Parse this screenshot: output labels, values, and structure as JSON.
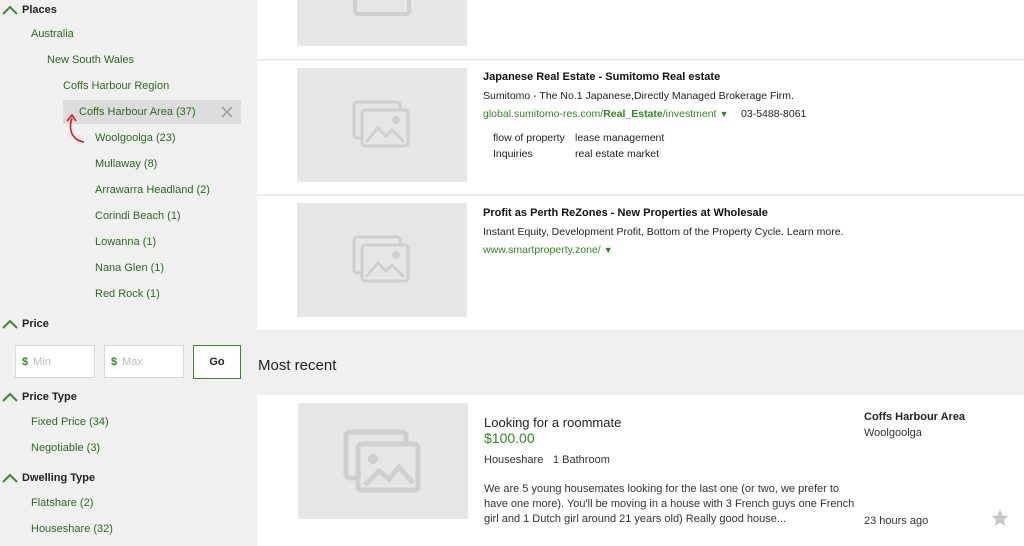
{
  "sidebar": {
    "places_heading": "Places",
    "places": [
      {
        "label": "Australia"
      },
      {
        "label": "New South Wales"
      },
      {
        "label": "Coffs Harbour Region"
      },
      {
        "label": "Coffs Harbour Area (37)"
      },
      {
        "label": "Woolgoolga (23)"
      },
      {
        "label": "Mullaway (8)"
      },
      {
        "label": "Arrawarra Headland (2)"
      },
      {
        "label": "Corindi Beach (1)"
      },
      {
        "label": "Lowanna (1)"
      },
      {
        "label": "Nana Glen (1)"
      },
      {
        "label": "Red Rock (1)"
      }
    ],
    "price_heading": "Price",
    "price_min_symbol": "$",
    "price_min_placeholder": "Min",
    "price_max_symbol": "$",
    "price_max_placeholder": "Max",
    "go_label": "Go",
    "price_type_heading": "Price Type",
    "price_types": [
      {
        "label": "Fixed Price (34)"
      },
      {
        "label": "Negotiable (3)"
      }
    ],
    "dwelling_type_heading": "Dwelling Type",
    "dwelling_types": [
      {
        "label": "Flatshare (2)"
      },
      {
        "label": "Houseshare (32)"
      }
    ]
  },
  "ads": [
    {
      "title": "Japanese Real Estate - Sumitomo Real estate",
      "desc": "Sumitomo - The No.1 Japanese,Directly Managed Brokerage Firm.",
      "url_pre": "global.sumitomo-res.com/",
      "url_bold": "Real_Estate",
      "url_post": "/investment",
      "url_arrow": "▼",
      "phone": "03-5488-8061",
      "sitelinks": [
        "flow of property",
        "lease management",
        "Inquiries",
        "real estate market"
      ]
    },
    {
      "title": "Profit as Perth ReZones - New Properties at Wholesale",
      "desc": "Instant Equity, Development Profit, Bottom of the Property Cycle. Learn more.",
      "url": "www.smartproperty.zone/",
      "url_arrow": "▼"
    }
  ],
  "most_recent_heading": "Most recent",
  "listing": {
    "title": "Looking for a roommate",
    "price": "$100.00",
    "type": "Houseshare",
    "bathrooms": "1 Bathroom",
    "description": "We are 5 young housemates looking for the last one (or two, we prefer to have one more). You'll be moving in a house with 3 French guys one French girl and 1 Dutch girl around 21 years old) Really good house...",
    "area": "Coffs Harbour Area",
    "suburb": "Woolgoolga",
    "time": "23 hours ago"
  },
  "colors": {
    "accent_green": "#2d8a1e",
    "link_green": "#2d6a1e",
    "sidebar_bg": "#f0f0f0",
    "placeholder_bg": "#e6e6e6"
  },
  "icons": {
    "chevron": "chevron-up-icon",
    "remove": "close-icon",
    "image": "image-placeholder-icon",
    "star": "star-icon",
    "arrow": "back-arrow-icon"
  }
}
